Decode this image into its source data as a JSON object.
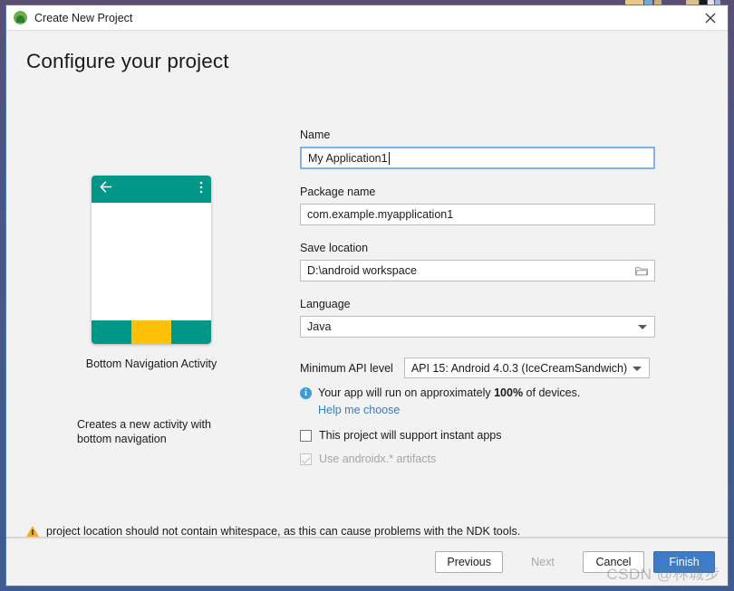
{
  "window": {
    "title": "Create New Project",
    "app_icon": "android-icon",
    "close_icon": "close-icon"
  },
  "heading": "Configure your project",
  "preview": {
    "title": "Bottom Navigation Activity",
    "description": "Creates a new activity with bottom navigation",
    "back_icon": "back-arrow-icon",
    "overflow_icon": "overflow-menu-icon",
    "appbar_color": "#009688",
    "nav_teal_color": "#009688",
    "nav_amber_color": "#ffc107"
  },
  "form": {
    "name": {
      "label": "Name",
      "value": "My Application1"
    },
    "package": {
      "label": "Package name",
      "value": "com.example.myapplication1"
    },
    "save_location": {
      "label": "Save location",
      "value": "D:\\android workspace",
      "browse_icon": "folder-icon"
    },
    "language": {
      "label": "Language",
      "value": "Java",
      "arrow_icon": "chevron-down-icon"
    },
    "api_level": {
      "label": "Minimum API level",
      "value": "API 15: Android 4.0.3 (IceCreamSandwich)",
      "arrow_icon": "chevron-down-icon"
    },
    "api_info": {
      "icon": "info-icon",
      "prefix": "Your app will run on approximately ",
      "percent": "100%",
      "suffix": " of devices.",
      "help_link": "Help me choose"
    },
    "instant_apps": {
      "label": "This project will support instant apps",
      "checked": false
    },
    "androidx": {
      "label": "Use androidx.* artifacts",
      "checked": true,
      "disabled": true
    }
  },
  "warning": {
    "icon": "warning-triangle-icon",
    "text": "project location should not contain whitespace, as this can cause problems with the NDK tools."
  },
  "footer": {
    "previous": "Previous",
    "next": "Next",
    "cancel": "Cancel",
    "finish": "Finish"
  },
  "watermark": "CSDN @林城步"
}
